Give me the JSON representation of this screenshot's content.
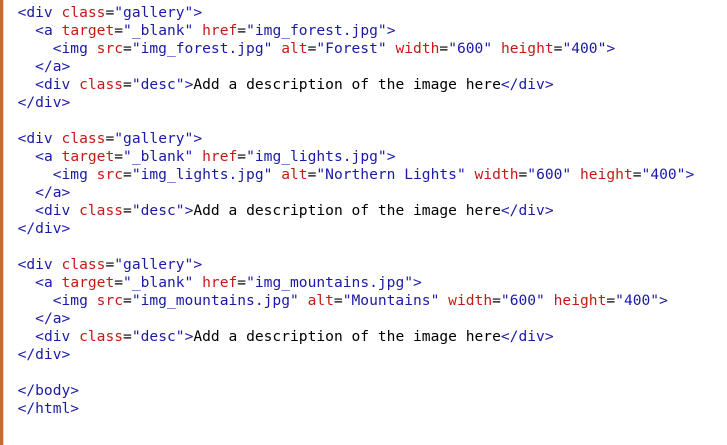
{
  "colors": {
    "tag": "#1a1aa6",
    "attribute": "#c41a16",
    "value": "#1a1aa6",
    "text": "#000000",
    "gutter_accent": "#c86a2a",
    "background": "#ffffff"
  },
  "lines": [
    [
      {
        "t": "  ",
        "k": "txt"
      },
      {
        "t": "<div",
        "k": "tag"
      },
      {
        "t": " ",
        "k": "txt"
      },
      {
        "t": "class",
        "k": "attr"
      },
      {
        "t": "=",
        "k": "txt"
      },
      {
        "t": "\"gallery\"",
        "k": "val"
      },
      {
        "t": ">",
        "k": "tag"
      }
    ],
    [
      {
        "t": "    ",
        "k": "txt"
      },
      {
        "t": "<a",
        "k": "tag"
      },
      {
        "t": " ",
        "k": "txt"
      },
      {
        "t": "target",
        "k": "attr"
      },
      {
        "t": "=",
        "k": "txt"
      },
      {
        "t": "\"_blank\"",
        "k": "val"
      },
      {
        "t": " ",
        "k": "txt"
      },
      {
        "t": "href",
        "k": "attr"
      },
      {
        "t": "=",
        "k": "txt"
      },
      {
        "t": "\"img_forest.jpg\"",
        "k": "val"
      },
      {
        "t": ">",
        "k": "tag"
      }
    ],
    [
      {
        "t": "      ",
        "k": "txt"
      },
      {
        "t": "<img",
        "k": "tag"
      },
      {
        "t": " ",
        "k": "txt"
      },
      {
        "t": "src",
        "k": "attr"
      },
      {
        "t": "=",
        "k": "txt"
      },
      {
        "t": "\"img_forest.jpg\"",
        "k": "val"
      },
      {
        "t": " ",
        "k": "txt"
      },
      {
        "t": "alt",
        "k": "attr"
      },
      {
        "t": "=",
        "k": "txt"
      },
      {
        "t": "\"Forest\"",
        "k": "val"
      },
      {
        "t": " ",
        "k": "txt"
      },
      {
        "t": "width",
        "k": "attr"
      },
      {
        "t": "=",
        "k": "txt"
      },
      {
        "t": "\"600\"",
        "k": "val"
      },
      {
        "t": " ",
        "k": "txt"
      },
      {
        "t": "height",
        "k": "attr"
      },
      {
        "t": "=",
        "k": "txt"
      },
      {
        "t": "\"400\"",
        "k": "val"
      },
      {
        "t": ">",
        "k": "tag"
      }
    ],
    [
      {
        "t": "    ",
        "k": "txt"
      },
      {
        "t": "</a>",
        "k": "tag"
      }
    ],
    [
      {
        "t": "    ",
        "k": "txt"
      },
      {
        "t": "<div",
        "k": "tag"
      },
      {
        "t": " ",
        "k": "txt"
      },
      {
        "t": "class",
        "k": "attr"
      },
      {
        "t": "=",
        "k": "txt"
      },
      {
        "t": "\"desc\"",
        "k": "val"
      },
      {
        "t": ">",
        "k": "tag"
      },
      {
        "t": "Add a description of the image here",
        "k": "txt"
      },
      {
        "t": "</div>",
        "k": "tag"
      }
    ],
    [
      {
        "t": "  ",
        "k": "txt"
      },
      {
        "t": "</div>",
        "k": "tag"
      }
    ],
    [],
    [
      {
        "t": "  ",
        "k": "txt"
      },
      {
        "t": "<div",
        "k": "tag"
      },
      {
        "t": " ",
        "k": "txt"
      },
      {
        "t": "class",
        "k": "attr"
      },
      {
        "t": "=",
        "k": "txt"
      },
      {
        "t": "\"gallery\"",
        "k": "val"
      },
      {
        "t": ">",
        "k": "tag"
      }
    ],
    [
      {
        "t": "    ",
        "k": "txt"
      },
      {
        "t": "<a",
        "k": "tag"
      },
      {
        "t": " ",
        "k": "txt"
      },
      {
        "t": "target",
        "k": "attr"
      },
      {
        "t": "=",
        "k": "txt"
      },
      {
        "t": "\"_blank\"",
        "k": "val"
      },
      {
        "t": " ",
        "k": "txt"
      },
      {
        "t": "href",
        "k": "attr"
      },
      {
        "t": "=",
        "k": "txt"
      },
      {
        "t": "\"img_lights.jpg\"",
        "k": "val"
      },
      {
        "t": ">",
        "k": "tag"
      }
    ],
    [
      {
        "t": "      ",
        "k": "txt"
      },
      {
        "t": "<img",
        "k": "tag"
      },
      {
        "t": " ",
        "k": "txt"
      },
      {
        "t": "src",
        "k": "attr"
      },
      {
        "t": "=",
        "k": "txt"
      },
      {
        "t": "\"img_lights.jpg\"",
        "k": "val"
      },
      {
        "t": " ",
        "k": "txt"
      },
      {
        "t": "alt",
        "k": "attr"
      },
      {
        "t": "=",
        "k": "txt"
      },
      {
        "t": "\"Northern Lights\"",
        "k": "val"
      },
      {
        "t": " ",
        "k": "txt"
      },
      {
        "t": "width",
        "k": "attr"
      },
      {
        "t": "=",
        "k": "txt"
      },
      {
        "t": "\"600\"",
        "k": "val"
      },
      {
        "t": " ",
        "k": "txt"
      },
      {
        "t": "height",
        "k": "attr"
      },
      {
        "t": "=",
        "k": "txt"
      },
      {
        "t": "\"400\"",
        "k": "val"
      },
      {
        "t": ">",
        "k": "tag"
      }
    ],
    [
      {
        "t": "    ",
        "k": "txt"
      },
      {
        "t": "</a>",
        "k": "tag"
      }
    ],
    [
      {
        "t": "    ",
        "k": "txt"
      },
      {
        "t": "<div",
        "k": "tag"
      },
      {
        "t": " ",
        "k": "txt"
      },
      {
        "t": "class",
        "k": "attr"
      },
      {
        "t": "=",
        "k": "txt"
      },
      {
        "t": "\"desc\"",
        "k": "val"
      },
      {
        "t": ">",
        "k": "tag"
      },
      {
        "t": "Add a description of the image here",
        "k": "txt"
      },
      {
        "t": "</div>",
        "k": "tag"
      }
    ],
    [
      {
        "t": "  ",
        "k": "txt"
      },
      {
        "t": "</div>",
        "k": "tag"
      }
    ],
    [],
    [
      {
        "t": "  ",
        "k": "txt"
      },
      {
        "t": "<div",
        "k": "tag"
      },
      {
        "t": " ",
        "k": "txt"
      },
      {
        "t": "class",
        "k": "attr"
      },
      {
        "t": "=",
        "k": "txt"
      },
      {
        "t": "\"gallery\"",
        "k": "val"
      },
      {
        "t": ">",
        "k": "tag"
      }
    ],
    [
      {
        "t": "    ",
        "k": "txt"
      },
      {
        "t": "<a",
        "k": "tag"
      },
      {
        "t": " ",
        "k": "txt"
      },
      {
        "t": "target",
        "k": "attr"
      },
      {
        "t": "=",
        "k": "txt"
      },
      {
        "t": "\"_blank\"",
        "k": "val"
      },
      {
        "t": " ",
        "k": "txt"
      },
      {
        "t": "href",
        "k": "attr"
      },
      {
        "t": "=",
        "k": "txt"
      },
      {
        "t": "\"img_mountains.jpg\"",
        "k": "val"
      },
      {
        "t": ">",
        "k": "tag"
      }
    ],
    [
      {
        "t": "      ",
        "k": "txt"
      },
      {
        "t": "<img",
        "k": "tag"
      },
      {
        "t": " ",
        "k": "txt"
      },
      {
        "t": "src",
        "k": "attr"
      },
      {
        "t": "=",
        "k": "txt"
      },
      {
        "t": "\"img_mountains.jpg\"",
        "k": "val"
      },
      {
        "t": " ",
        "k": "txt"
      },
      {
        "t": "alt",
        "k": "attr"
      },
      {
        "t": "=",
        "k": "txt"
      },
      {
        "t": "\"Mountains\"",
        "k": "val"
      },
      {
        "t": " ",
        "k": "txt"
      },
      {
        "t": "width",
        "k": "attr"
      },
      {
        "t": "=",
        "k": "txt"
      },
      {
        "t": "\"600\"",
        "k": "val"
      },
      {
        "t": " ",
        "k": "txt"
      },
      {
        "t": "height",
        "k": "attr"
      },
      {
        "t": "=",
        "k": "txt"
      },
      {
        "t": "\"400\"",
        "k": "val"
      },
      {
        "t": ">",
        "k": "tag"
      }
    ],
    [
      {
        "t": "    ",
        "k": "txt"
      },
      {
        "t": "</a>",
        "k": "tag"
      }
    ],
    [
      {
        "t": "    ",
        "k": "txt"
      },
      {
        "t": "<div",
        "k": "tag"
      },
      {
        "t": " ",
        "k": "txt"
      },
      {
        "t": "class",
        "k": "attr"
      },
      {
        "t": "=",
        "k": "txt"
      },
      {
        "t": "\"desc\"",
        "k": "val"
      },
      {
        "t": ">",
        "k": "tag"
      },
      {
        "t": "Add a description of the image here",
        "k": "txt"
      },
      {
        "t": "</div>",
        "k": "tag"
      }
    ],
    [
      {
        "t": "  ",
        "k": "txt"
      },
      {
        "t": "</div>",
        "k": "tag"
      }
    ],
    [],
    [
      {
        "t": "  ",
        "k": "txt"
      },
      {
        "t": "</body>",
        "k": "tag"
      }
    ],
    [
      {
        "t": "  ",
        "k": "txt"
      },
      {
        "t": "</html>",
        "k": "tag"
      }
    ]
  ]
}
